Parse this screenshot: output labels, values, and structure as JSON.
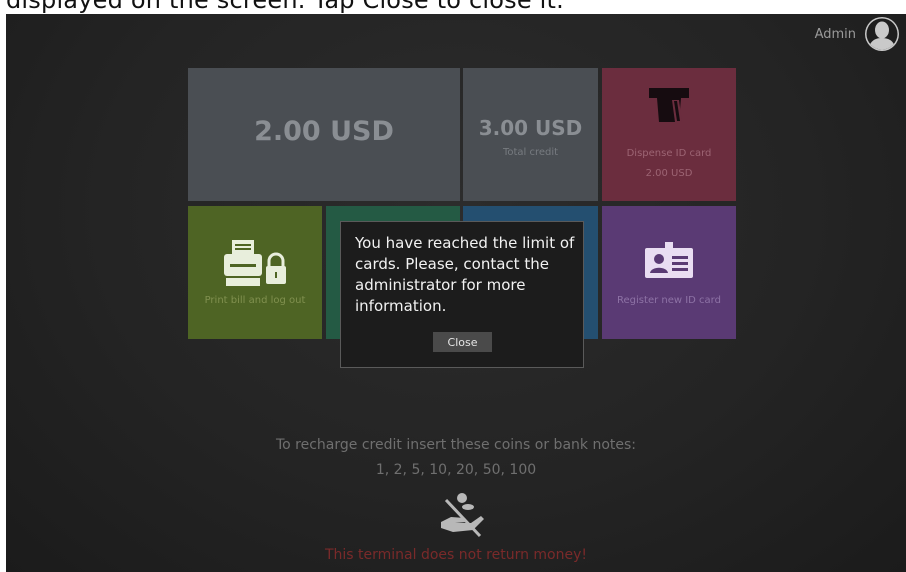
{
  "caption": "displayed on the screen. Tap Close to close it.",
  "header": {
    "user_name": "Admin",
    "avatar_icon": "user-avatar-icon"
  },
  "tiles": {
    "amount": {
      "value": "2.00 USD"
    },
    "credit": {
      "value": "3.00 USD",
      "label": "Total credit"
    },
    "dispense": {
      "icon": "card-dispenser-icon",
      "label": "Dispense ID card",
      "amount": "2.00 USD",
      "color": "#6b2d3e"
    },
    "print": {
      "icon": "printer-lock-icon",
      "label": "Print bill and log out",
      "color": "#4e6424"
    },
    "green": {
      "color": "#245a44"
    },
    "blue": {
      "color": "#244f70"
    },
    "register": {
      "icon": "id-card-icon",
      "label": "Register new ID card",
      "color": "#5a3a74"
    }
  },
  "dialog": {
    "message": "You have reached the limit of cards. Please, contact the administrator for more information.",
    "close_label": "Close"
  },
  "recharge": {
    "instruction": "To recharge credit insert these coins or bank notes:",
    "denominations": "1, 2, 5, 10, 20, 50, 100",
    "icon": "no-change-icon"
  },
  "warning": {
    "text": "This terminal does not return money!",
    "color": "#7a2a2a"
  }
}
